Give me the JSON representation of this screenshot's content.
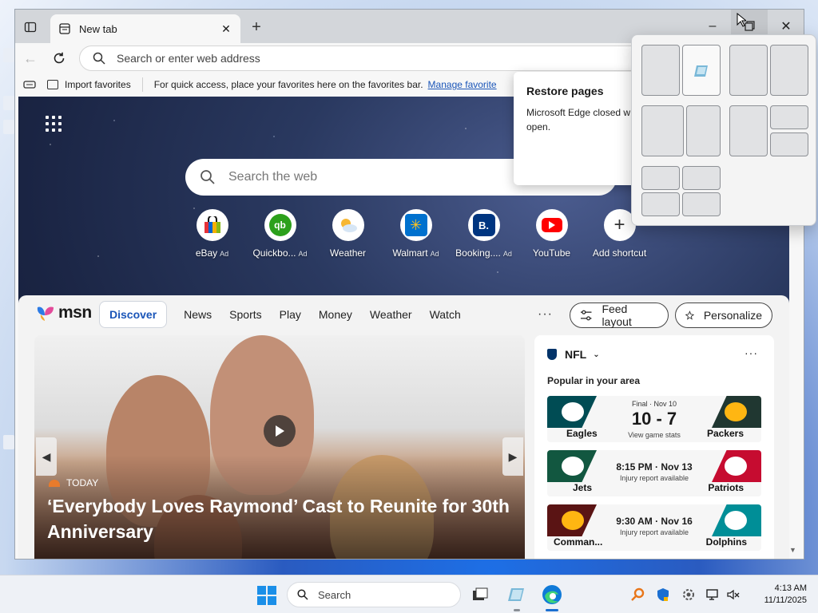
{
  "window": {
    "tab_title": "New tab",
    "address_placeholder": "Search or enter web address"
  },
  "favorites_bar": {
    "import_label": "Import favorites",
    "hint": "For quick access, place your favorites here on the favorites bar.",
    "manage_link": "Manage favorite"
  },
  "newtab": {
    "search_placeholder": "Search the web",
    "shortcuts": [
      {
        "label": "eBay",
        "ad": "Ad",
        "icon": "ebay-icon",
        "color": "#ffffff"
      },
      {
        "label": "Quickbo...",
        "ad": "Ad",
        "icon": "quickbooks-icon",
        "color": "#2ca01c"
      },
      {
        "label": "Weather",
        "ad": "",
        "icon": "weather-icon",
        "color": "#f2b233"
      },
      {
        "label": "Walmart",
        "ad": "Ad",
        "icon": "walmart-icon",
        "color": "#0071ce"
      },
      {
        "label": "Booking....",
        "ad": "Ad",
        "icon": "booking-icon",
        "color": "#003580"
      },
      {
        "label": "YouTube",
        "ad": "",
        "icon": "youtube-icon",
        "color": "#ff0000"
      },
      {
        "label": "Add shortcut",
        "ad": "",
        "icon": "plus-icon",
        "color": "#ffffff"
      }
    ]
  },
  "msn": {
    "logo_text": "msn",
    "nav": [
      "Discover",
      "News",
      "Sports",
      "Play",
      "Money",
      "Weather",
      "Watch"
    ],
    "more": "···",
    "feed_layout_label": "Feed layout",
    "personalize_label": "Personalize"
  },
  "hero": {
    "source": "TODAY",
    "headline": "‘Everybody Loves Raymond’ Cast to Reunite for 30th Anniversary"
  },
  "nfl": {
    "title": "NFL",
    "subtitle": "Popular in your area",
    "games": [
      {
        "status": "Final · Nov 10",
        "score": "10 - 7",
        "note": "View game stats",
        "team1": "Eagles",
        "team2": "Packers",
        "team1_color": "#004c54",
        "team2_color": "#203731"
      },
      {
        "time": "8:15 PM · Nov 13",
        "note": "Injury report available",
        "team1": "Jets",
        "team2": "Patriots",
        "team1_color": "#125740",
        "team2_color": "#c60c30"
      },
      {
        "time": "9:30 AM · Nov 16",
        "note": "Injury report available",
        "team1": "Comman...",
        "team2": "Dolphins",
        "team1_color": "#5a1414",
        "team2_color": "#008e97"
      }
    ]
  },
  "restore_popup": {
    "title": "Restore pages",
    "message": "Microsoft Edge closed w open."
  },
  "taskbar": {
    "search_label": "Search",
    "time": "4:13 AM",
    "date": "11/11/2025"
  },
  "colors": {
    "accent": "#1a55b8",
    "windows_blue": "#1b8fe8"
  }
}
